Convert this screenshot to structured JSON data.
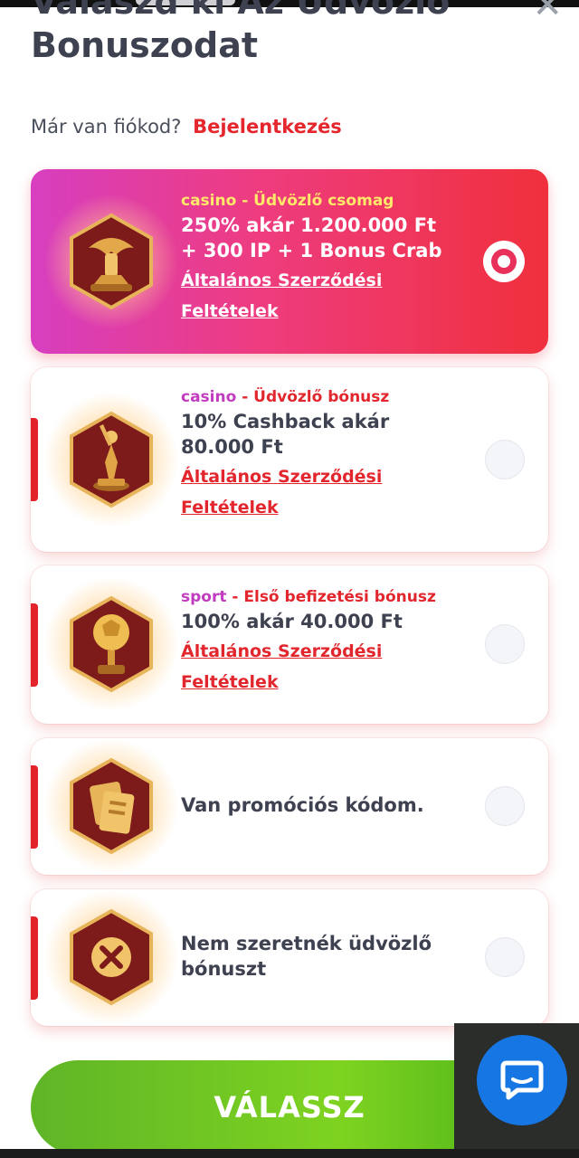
{
  "modal": {
    "title": "Válaszd ki Az Üdvözlő Bonuszodat",
    "login_prompt": "Már van fiókod?",
    "login_link": "Bejelentkezés"
  },
  "offers": [
    {
      "category": "casino",
      "type": " - Üdvözlő csomag",
      "headline_line1": "250% akár 1.200.000 Ft",
      "headline_line2": "+ 300 IP + 1 Bonus Crab",
      "terms_line1": "Általános Szerződési",
      "terms_line2": "Feltételek",
      "selected": true,
      "icon": "winged-lion-trophy-icon"
    },
    {
      "category": "casino",
      "type": " - Üdvözlő bónusz",
      "headline_line1": "10% Cashback akár",
      "headline_line2": "80.000 Ft",
      "terms_line1": "Általános Szerződési",
      "terms_line2": "Feltételek",
      "selected": false,
      "icon": "statuette-trophy-icon"
    },
    {
      "category": "sport",
      "type": " - Első befizetési bónusz",
      "headline_line1": "100% akár 40.000 Ft",
      "terms_line1": "Általános Szerződési",
      "terms_line2": "Feltételek",
      "selected": false,
      "icon": "golden-ball-trophy-icon"
    },
    {
      "label": "Van promóciós kódom.",
      "selected": false,
      "icon": "promo-code-cards-icon"
    },
    {
      "label_line1": "Nem szeretnék üdvözlő",
      "label_line2": "bónuszt",
      "selected": false,
      "icon": "no-bonus-x-icon"
    }
  ],
  "cta": {
    "label": "VÁLASSZ"
  },
  "chat": {
    "icon": "chat-bubble-icon"
  },
  "colors": {
    "accent_red": "#e2262d",
    "selected_gradient_start": "#d73fc0",
    "selected_gradient_end": "#f0303c",
    "cta_green": "#7ed321",
    "chat_blue": "#1676e4"
  }
}
